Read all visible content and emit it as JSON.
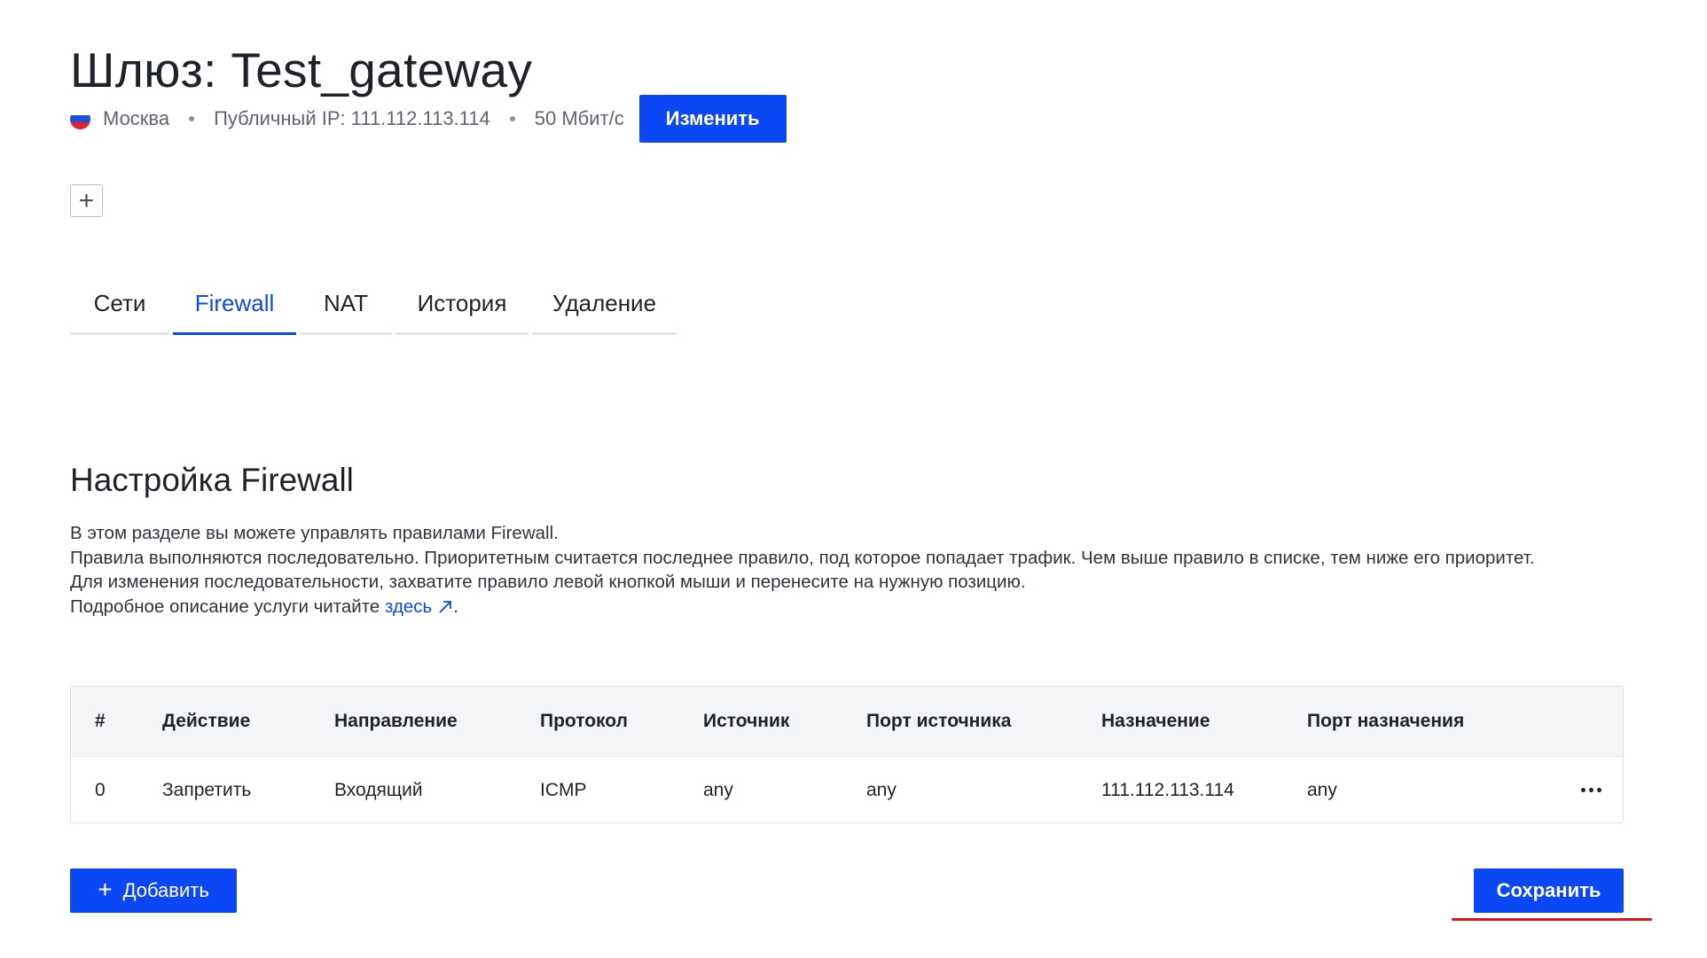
{
  "header": {
    "title": "Шлюз: Test_gateway",
    "location": "Москва",
    "public_ip": "Публичный IP: 111.112.113.114",
    "bandwidth": "50 Мбит/с",
    "edit_label": "Изменить",
    "add_tag_icon": "+"
  },
  "tabs": [
    {
      "label": "Сети"
    },
    {
      "label": "Firewall",
      "active": true
    },
    {
      "label": "NAT"
    },
    {
      "label": "История"
    },
    {
      "label": "Удаление"
    }
  ],
  "section": {
    "title": "Настройка Firewall",
    "description": [
      "В этом разделе вы можете управлять правилами Firewall.",
      "Правила выполняются последовательно. Приоритетным считается последнее правило, под которое попадает трафик. Чем выше правило в списке, тем ниже его приоритет.",
      "Для изменения последовательности, захватите правило левой кнопкой мыши и перенесите на нужную позицию."
    ],
    "details_prefix": "Подробное описание услуги читайте",
    "details_link": "здесь",
    "details_suffix": "."
  },
  "table": {
    "columns": [
      "#",
      "Действие",
      "Направление",
      "Протокол",
      "Источник",
      "Порт источника",
      "Назначение",
      "Порт назначения"
    ],
    "rows": [
      [
        "0",
        "Запретить",
        "Входящий",
        "ICMP",
        "any",
        "any",
        "111.112.113.114",
        "any"
      ]
    ]
  },
  "actions": {
    "add_label": "Добавить",
    "save_label": "Сохранить"
  },
  "colors": {
    "accent": "#0b47f5",
    "highlight": "#e0141e"
  }
}
